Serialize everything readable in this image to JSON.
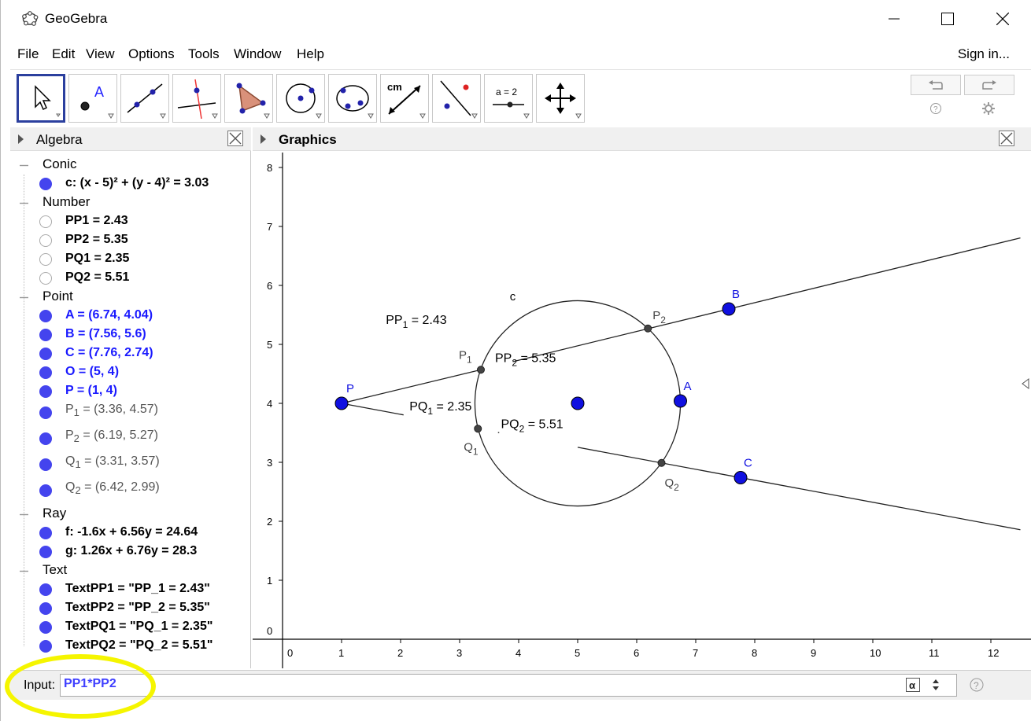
{
  "window": {
    "title": "GeoGebra"
  },
  "menu": {
    "items": [
      "File",
      "Edit",
      "View",
      "Options",
      "Tools",
      "Window",
      "Help"
    ],
    "signin": "Sign in..."
  },
  "toolbar": {
    "tools": [
      "move",
      "point",
      "line",
      "perpendicular",
      "polygon",
      "circle-center",
      "circle-3-points",
      "distance",
      "reflect",
      "slider",
      "move-graphics"
    ],
    "distance_label": "cm",
    "slider_label": "a = 2",
    "point_label": "A"
  },
  "algebra": {
    "title": "Algebra",
    "categories": [
      {
        "name": "Conic",
        "items": [
          {
            "text": "c: (x - 5)² + (y - 4)² = 3.03",
            "on": true
          }
        ]
      },
      {
        "name": "Number",
        "items": [
          {
            "text": "PP1 = 2.43",
            "on": false
          },
          {
            "text": "PP2 = 5.35",
            "on": false
          },
          {
            "text": "PQ1 = 2.35",
            "on": false
          },
          {
            "text": "PQ2 = 5.51",
            "on": false
          }
        ]
      },
      {
        "name": "Point",
        "items": [
          {
            "text": "A = (6.74, 4.04)",
            "on": true
          },
          {
            "text": "B = (7.56, 5.6)",
            "on": true
          },
          {
            "text": "C = (7.76, 2.74)",
            "on": true
          },
          {
            "text": "O = (5, 4)",
            "on": true
          },
          {
            "text": "P = (1, 4)",
            "on": true
          },
          {
            "base": "P",
            "sub": "1",
            "rest": " = (3.36, 4.57)",
            "on": true
          },
          {
            "base": "P",
            "sub": "2",
            "rest": " = (6.19, 5.27)",
            "on": true
          },
          {
            "base": "Q",
            "sub": "1",
            "rest": " = (3.31, 3.57)",
            "on": true
          },
          {
            "base": "Q",
            "sub": "2",
            "rest": " = (6.42, 2.99)",
            "on": true
          }
        ]
      },
      {
        "name": "Ray",
        "items": [
          {
            "text": "f: -1.6x + 6.56y = 24.64",
            "on": true
          },
          {
            "text": "g: 1.26x + 6.76y = 28.3",
            "on": true
          }
        ]
      },
      {
        "name": "Text",
        "items": [
          {
            "text": "TextPP1 = \"PP_1 = 2.43\"",
            "on": true
          },
          {
            "text": "TextPP2 = \"PP_2 = 5.35\"",
            "on": true
          },
          {
            "text": "TextPQ1 = \"PQ_1 = 2.35\"",
            "on": true
          },
          {
            "text": "TextPQ2 = \"PQ_2 = 5.51\"",
            "on": true
          }
        ]
      }
    ]
  },
  "graphics": {
    "title": "Graphics",
    "x_ticks": [
      "0",
      "1",
      "2",
      "3",
      "4",
      "5",
      "6",
      "7",
      "8",
      "9",
      "10",
      "11",
      "12"
    ],
    "y_ticks": [
      "0",
      "1",
      "2",
      "3",
      "4",
      "5",
      "6",
      "7",
      "8"
    ],
    "circle": {
      "cx": 5,
      "cy": 4,
      "r": 1.7407,
      "label": "c"
    },
    "points": [
      {
        "name": "P",
        "x": 1,
        "y": 4
      },
      {
        "name": "A",
        "x": 6.74,
        "y": 4.04
      },
      {
        "name": "B",
        "x": 7.56,
        "y": 5.6
      },
      {
        "name": "C",
        "x": 7.76,
        "y": 2.74
      },
      {
        "name": "O",
        "x": 5,
        "y": 4
      }
    ],
    "small_points": [
      {
        "base": "P",
        "sub": "1",
        "x": 3.36,
        "y": 4.57
      },
      {
        "base": "P",
        "sub": "2",
        "x": 6.19,
        "y": 5.27
      },
      {
        "base": "Q",
        "sub": "1",
        "x": 3.31,
        "y": 3.57
      },
      {
        "base": "Q",
        "sub": "2",
        "x": 6.42,
        "y": 2.99
      }
    ],
    "texts": [
      {
        "base": "PP",
        "sub": "1",
        "rest": " = 2.43",
        "x": 1.75,
        "y": 5.35
      },
      {
        "base": "PP",
        "sub": "2",
        "rest": " = 5.35",
        "x": 3.6,
        "y": 4.7
      },
      {
        "base": "PQ",
        "sub": "1",
        "rest": " = 2.35",
        "x": 2.15,
        "y": 3.88
      },
      {
        "base": "PQ",
        "sub": "2",
        "rest": " = 5.51",
        "x": 3.7,
        "y": 3.58
      }
    ]
  },
  "input": {
    "label": "Input:",
    "value": "PP1*PP2"
  }
}
